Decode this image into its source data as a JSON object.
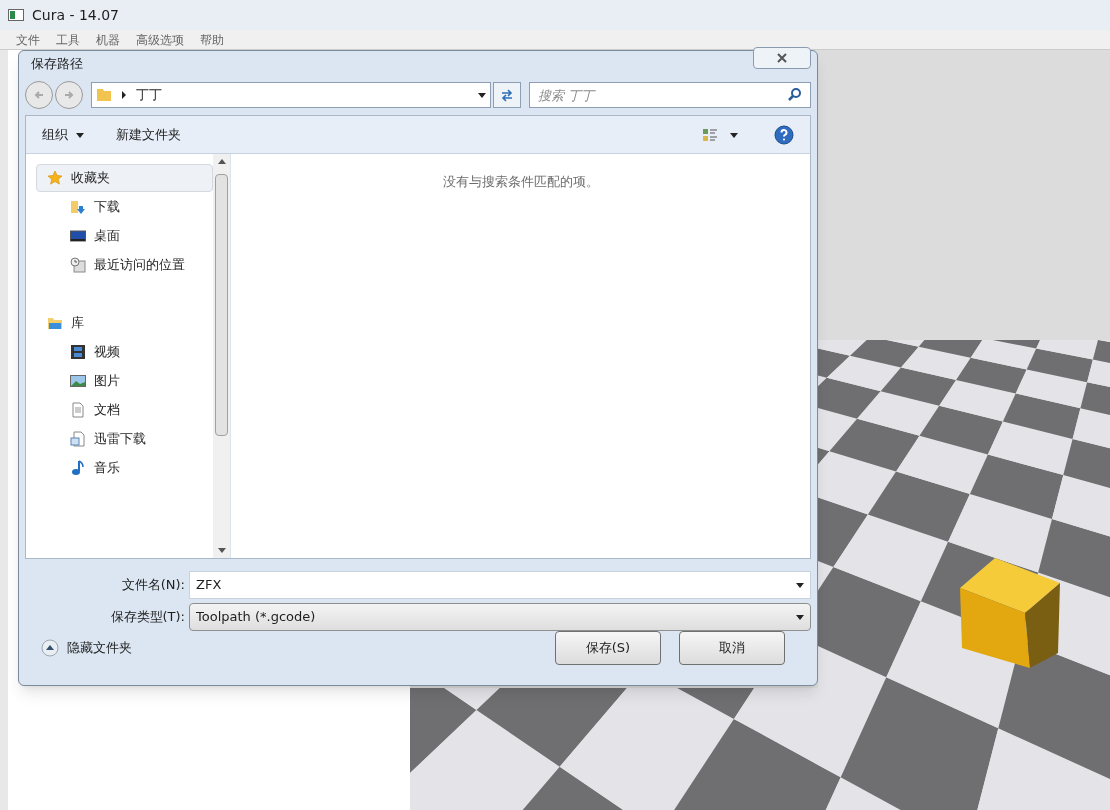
{
  "app_window": {
    "title": "Cura - 14.07",
    "menu": [
      "文件",
      "工具",
      "机器",
      "高级选项",
      "帮助"
    ]
  },
  "dialog": {
    "title": "保存路径",
    "address": {
      "path": [
        "丁丁"
      ]
    },
    "search": {
      "placeholder": "搜索 丁丁"
    },
    "toolbar": {
      "organize": "组织",
      "new_folder": "新建文件夹"
    },
    "nav_tree": [
      {
        "label": "收藏夹",
        "kind": "star",
        "selected": true,
        "children": [
          {
            "label": "下载",
            "kind": "download",
            "selected": false
          },
          {
            "label": "桌面",
            "kind": "desktop",
            "selected": false
          },
          {
            "label": "最近访问的位置",
            "kind": "recent",
            "selected": false
          }
        ]
      },
      {
        "label": "库",
        "kind": "library",
        "selected": false,
        "children": [
          {
            "label": "视频",
            "kind": "video",
            "selected": false
          },
          {
            "label": "图片",
            "kind": "picture",
            "selected": false
          },
          {
            "label": "文档",
            "kind": "document",
            "selected": false
          },
          {
            "label": "迅雷下载",
            "kind": "document2",
            "selected": false
          },
          {
            "label": "音乐",
            "kind": "music",
            "selected": false
          }
        ]
      }
    ],
    "empty_message": "没有与搜索条件匹配的项。",
    "fields": [
      {
        "label": "文件名(N):",
        "value": "ZFX",
        "kind": "combo"
      },
      {
        "label": "保存类型(T):",
        "value": "Toolpath (*.gcode)",
        "kind": "select"
      }
    ],
    "hide_folders": "隐藏文件夹",
    "buttons": [
      "保存(S)",
      "取消"
    ]
  }
}
